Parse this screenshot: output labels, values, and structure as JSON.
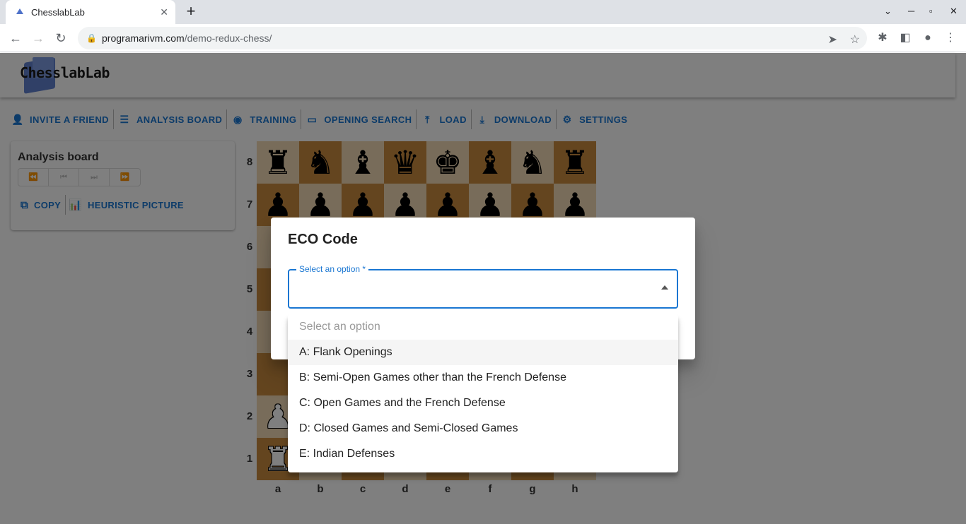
{
  "browser": {
    "tab_title": "ChesslabLab",
    "url_host": "programarivm.com",
    "url_path": "/demo-redux-chess/"
  },
  "app": {
    "logo_text": "ChesslabLab",
    "menu": [
      {
        "label": "INVITE A FRIEND",
        "icon": "person-add-icon",
        "glyph": "👤"
      },
      {
        "label": "ANALYSIS BOARD",
        "icon": "tune-icon",
        "glyph": "☰"
      },
      {
        "label": "TRAINING",
        "icon": "psychology-icon",
        "glyph": "◉"
      },
      {
        "label": "OPENING SEARCH",
        "icon": "computer-icon",
        "glyph": "▭"
      },
      {
        "label": "LOAD",
        "icon": "upload-icon",
        "glyph": "⤒"
      },
      {
        "label": "DOWNLOAD",
        "icon": "download-icon",
        "glyph": "⤓"
      },
      {
        "label": "SETTINGS",
        "icon": "settings-icon",
        "glyph": "⚙"
      }
    ]
  },
  "panel": {
    "title": "Analysis board",
    "nav": [
      "⏪",
      "⏮",
      "⏭",
      "⏩"
    ],
    "copy_label": "COPY",
    "heuristic_label": "HEURISTIC PICTURE"
  },
  "board": {
    "ranks": [
      "8",
      "7",
      "6",
      "5",
      "4",
      "3",
      "2",
      "1"
    ],
    "files": [
      "a",
      "b",
      "c",
      "d",
      "e",
      "f",
      "g",
      "h"
    ],
    "rank8": [
      "♜",
      "♞",
      "♝",
      "♛",
      "♚",
      "♝",
      "♞",
      "♜"
    ],
    "rank7": [
      "♟",
      "♟",
      "♟",
      "♟",
      "♟",
      "♟",
      "♟",
      "♟"
    ],
    "rank2": [
      "♟",
      "♟",
      "♟",
      "♟",
      "♟",
      "♟",
      "♟",
      "♟"
    ],
    "rank1": [
      "♜",
      "♞",
      "♝",
      "♛",
      "♚",
      "♝",
      "♞",
      "♜"
    ]
  },
  "dialog": {
    "title": "ECO Code",
    "select_label": "Select an option *",
    "options": [
      "Select an option",
      "A: Flank Openings",
      "B: Semi-Open Games other than the French Defense",
      "C: Open Games and the French Defense",
      "D: Closed Games and Semi-Closed Games",
      "E: Indian Defenses"
    ]
  }
}
